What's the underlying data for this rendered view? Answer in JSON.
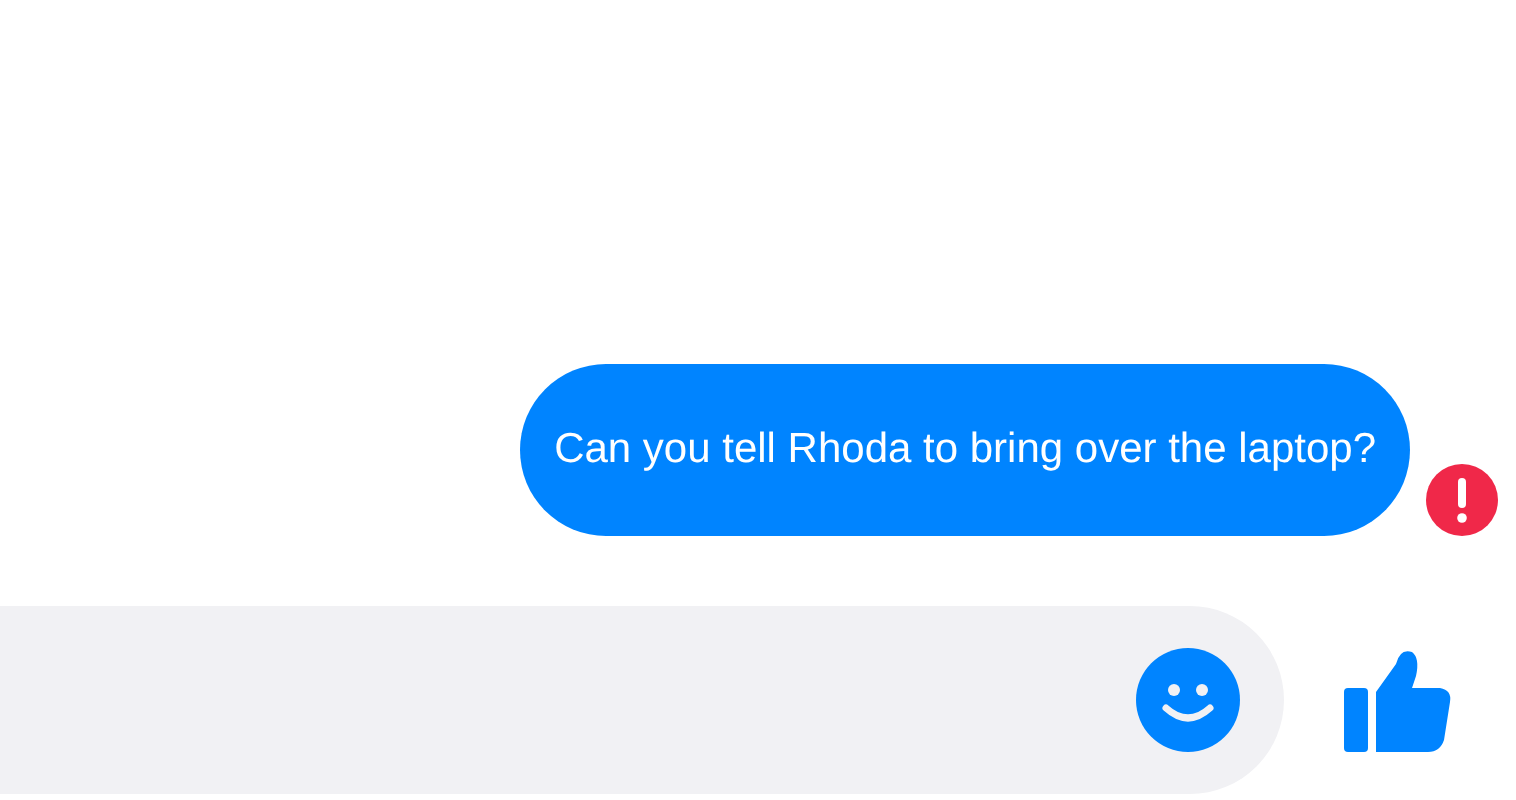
{
  "messages": [
    {
      "text": "Can you tell Rhoda to bring over the laptop?",
      "failed": true
    }
  ]
}
